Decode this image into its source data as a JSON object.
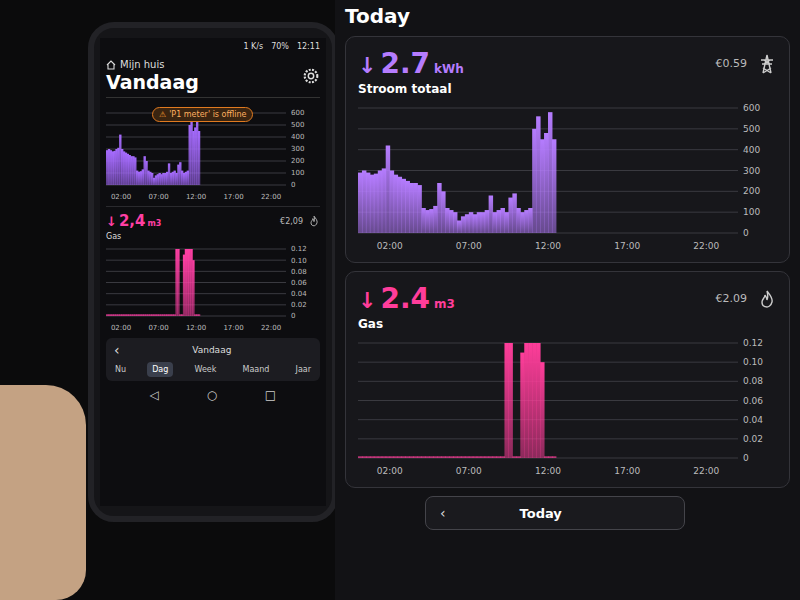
{
  "phone": {
    "status_bar": {
      "speed": "1 K/s",
      "battery": "70%",
      "time": "12:11"
    },
    "home_label": "Mijn huis",
    "title": "Vandaag",
    "warning": {
      "icon": "⚠",
      "text": "'P1 meter' is offline"
    },
    "power_chart": {
      "kind": "power",
      "color": "#a66bff",
      "y_ticks": [
        "600",
        "500",
        "400",
        "300",
        "200",
        "100",
        "0"
      ],
      "x_ticks": [
        "02:00",
        "07:00",
        "12:00",
        "17:00",
        "22:00"
      ],
      "values": [
        290,
        300,
        290,
        280,
        285,
        300,
        310,
        420,
        300,
        280,
        270,
        260,
        250,
        240,
        240,
        230,
        120,
        110,
        115,
        130,
        240,
        200,
        120,
        110,
        100,
        60,
        80,
        90,
        100,
        90,
        100,
        100,
        110,
        180,
        100,
        110,
        120,
        100,
        170,
        190,
        120,
        100,
        110,
        120,
        500,
        560,
        450,
        480,
        580,
        450
      ]
    },
    "gas_card": {
      "kind": "gas",
      "arrow": "↓",
      "value": "2,4",
      "unit": "m3",
      "title": "Gas",
      "cost": "€2,09",
      "color": "#ff3fa4",
      "y_ticks": [
        "0.12",
        "0.10",
        "0.08",
        "0.06",
        "0.04",
        "0.02",
        "0"
      ],
      "x_ticks": [
        "02:00",
        "07:00",
        "12:00",
        "17:00",
        "22:00"
      ],
      "values": [
        0,
        0,
        0,
        0,
        0,
        0,
        0,
        0,
        0,
        0,
        0,
        0,
        0,
        0,
        0,
        0,
        0,
        0,
        0,
        0,
        0,
        0,
        0,
        0,
        0,
        0,
        0,
        0,
        0,
        0,
        0,
        0,
        0,
        0,
        0,
        0,
        0,
        0.12,
        0.12,
        0,
        0,
        0.11,
        0.12,
        0.12,
        0.12,
        0.12,
        0.1,
        0,
        0,
        0
      ]
    },
    "period_picker": {
      "back": "‹",
      "label": "Vandaag",
      "tabs": [
        {
          "label": "Nu",
          "selected": false
        },
        {
          "label": "Dag",
          "selected": true
        },
        {
          "label": "Week",
          "selected": false
        },
        {
          "label": "Maand",
          "selected": false
        },
        {
          "label": "Jaar",
          "selected": false
        }
      ]
    },
    "nav": [
      "◁",
      "○",
      "□"
    ]
  },
  "monitor": {
    "title": "Today",
    "cards": [
      {
        "kind": "power",
        "arrow": "↓",
        "value": "2.7",
        "unit": "kWh",
        "title": "Stroom totaal",
        "cost": "€0.59",
        "color": "#b57cff",
        "y_ticks": [
          "600",
          "500",
          "400",
          "300",
          "200",
          "100",
          "0"
        ],
        "x_ticks": [
          "02:00",
          "07:00",
          "12:00",
          "17:00",
          "22:00"
        ],
        "values": [
          290,
          300,
          290,
          280,
          285,
          300,
          310,
          420,
          300,
          280,
          270,
          260,
          250,
          240,
          240,
          230,
          120,
          110,
          115,
          130,
          240,
          200,
          120,
          110,
          100,
          60,
          80,
          90,
          100,
          90,
          100,
          100,
          110,
          180,
          100,
          110,
          120,
          100,
          170,
          190,
          120,
          100,
          110,
          120,
          500,
          560,
          450,
          480,
          580,
          450
        ]
      },
      {
        "kind": "gas",
        "arrow": "↓",
        "value": "2.4",
        "unit": "m3",
        "title": "Gas",
        "cost": "€2.09",
        "color": "#ff3d9a",
        "y_ticks": [
          "0.12",
          "0.10",
          "0.08",
          "0.06",
          "0.04",
          "0.02",
          "0"
        ],
        "x_ticks": [
          "02:00",
          "07:00",
          "12:00",
          "17:00",
          "22:00"
        ],
        "values": [
          0,
          0,
          0,
          0,
          0,
          0,
          0,
          0,
          0,
          0,
          0,
          0,
          0,
          0,
          0,
          0,
          0,
          0,
          0,
          0,
          0,
          0,
          0,
          0,
          0,
          0,
          0,
          0,
          0,
          0,
          0,
          0,
          0,
          0,
          0,
          0,
          0,
          0.12,
          0.12,
          0,
          0,
          0.11,
          0.12,
          0.12,
          0.12,
          0.12,
          0.1,
          0,
          0,
          0
        ]
      }
    ],
    "period_picker": {
      "back": "‹",
      "label": "Today"
    }
  }
}
